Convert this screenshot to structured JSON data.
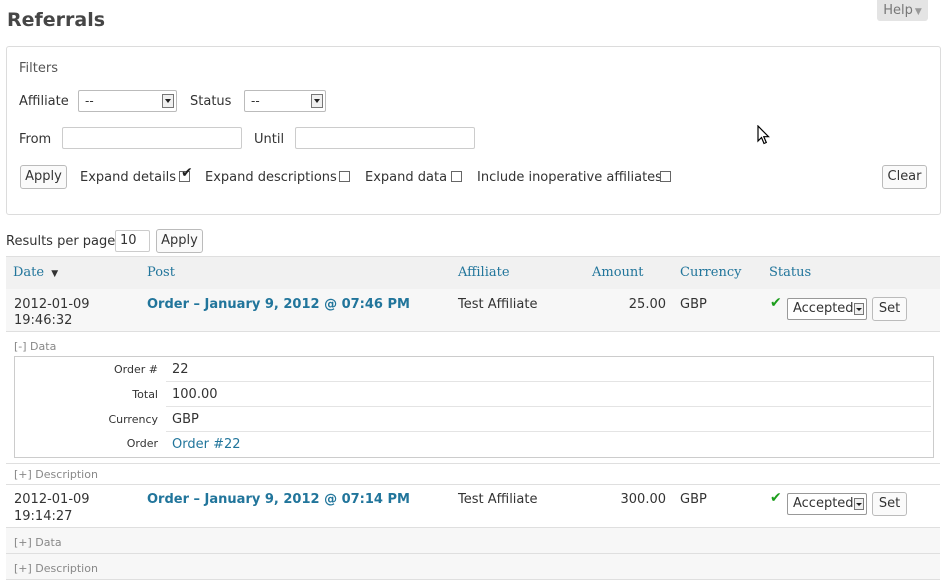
{
  "page": {
    "title": "Referrals",
    "help_label": "Help"
  },
  "filters": {
    "heading": "Filters",
    "affiliate_label": "Affiliate",
    "affiliate_value": "--",
    "status_label": "Status",
    "status_value": "--",
    "from_label": "From",
    "from_value": "",
    "until_label": "Until",
    "until_value": "",
    "apply_label": "Apply",
    "expand_details_label": "Expand details",
    "expand_details_checked": true,
    "expand_descriptions_label": "Expand descriptions",
    "expand_descriptions_checked": false,
    "expand_data_label": "Expand data",
    "expand_data_checked": false,
    "include_inoperative_label": "Include inoperative affiliates",
    "include_inoperative_checked": false,
    "clear_label": "Clear"
  },
  "results": {
    "per_page_label": "Results per page",
    "per_page_value": "10",
    "apply_label": "Apply"
  },
  "table": {
    "columns": [
      "Date",
      "Post",
      "Affiliate",
      "Amount",
      "Currency",
      "Status"
    ],
    "sort_indicator": "▼",
    "rows": [
      {
        "date": "2012-01-09",
        "time": "19:46:32",
        "post": "Order – January 9, 2012 @ 07:46 PM",
        "affiliate": "Test Affiliate",
        "amount": "25.00",
        "currency": "GBP",
        "status": "Accepted",
        "set_label": "Set",
        "data_toggle": "[-] Data",
        "description_toggle": "[+] Description",
        "data": [
          {
            "label": "Order #",
            "value": "22"
          },
          {
            "label": "Total",
            "value": "100.00"
          },
          {
            "label": "Currency",
            "value": "GBP"
          },
          {
            "label": "Order",
            "value": "Order #22"
          }
        ]
      },
      {
        "date": "2012-01-09",
        "time": "19:14:27",
        "post": "Order – January 9, 2012 @ 07:14 PM",
        "affiliate": "Test Affiliate",
        "amount": "300.00",
        "currency": "GBP",
        "status": "Accepted",
        "set_label": "Set",
        "data_toggle": "[+] Data",
        "description_toggle": "[+] Description"
      }
    ]
  },
  "colors": {
    "link": "#21759b",
    "accepted": "#1c9e1c",
    "header_bg": "#f1f1f1"
  }
}
